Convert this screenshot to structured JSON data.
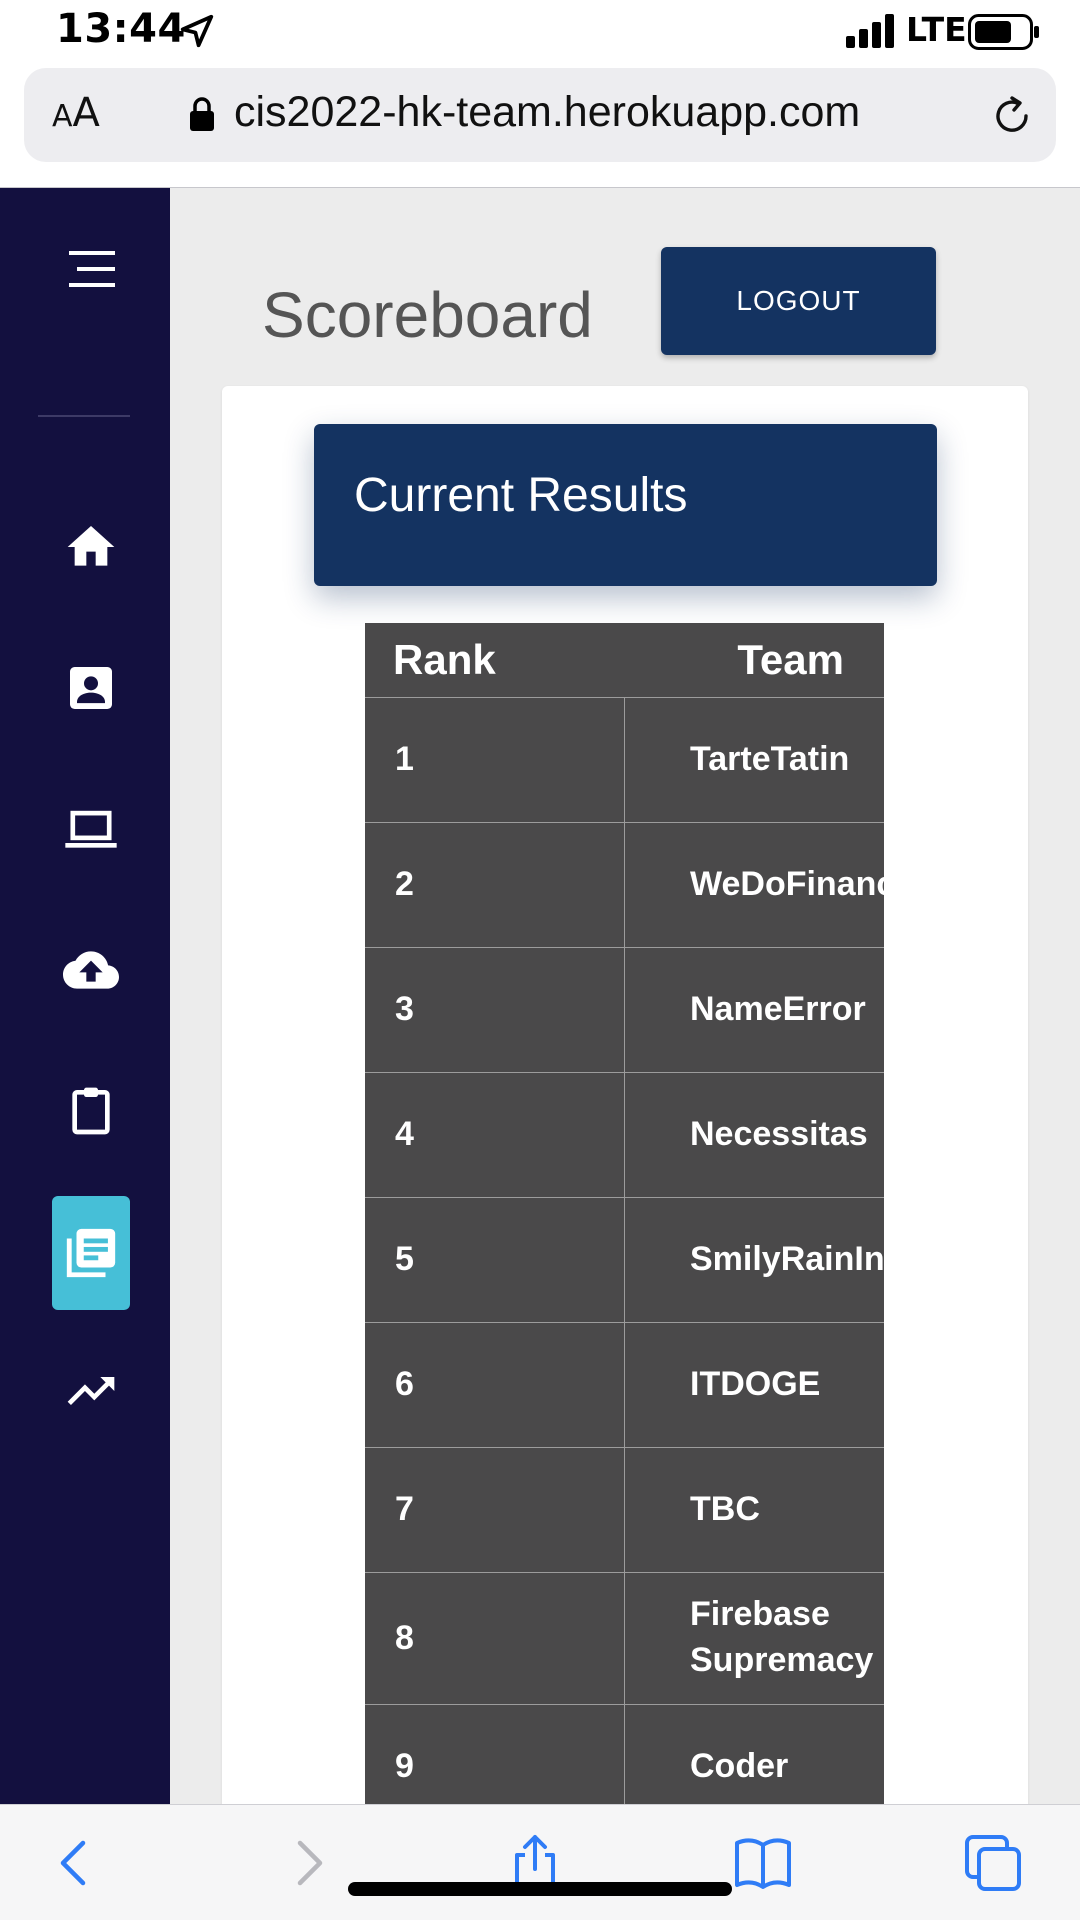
{
  "status_bar": {
    "time": "13:44",
    "network": "LTE"
  },
  "browser": {
    "text_size_small": "A",
    "text_size_large": "A",
    "url": "cis2022-hk-team.herokuapp.com"
  },
  "sidebar": {
    "items": [
      {
        "icon": "menu-icon",
        "active": false
      },
      {
        "icon": "home-icon",
        "active": false
      },
      {
        "icon": "profile-icon",
        "active": false
      },
      {
        "icon": "laptop-icon",
        "active": false
      },
      {
        "icon": "cloud-upload-icon",
        "active": false
      },
      {
        "icon": "clipboard-icon",
        "active": false
      },
      {
        "icon": "scoreboard-icon",
        "active": true
      },
      {
        "icon": "trending-up-icon",
        "active": false
      }
    ],
    "bg_color": "#13103f",
    "active_color": "#46bfd7"
  },
  "header": {
    "title": "Scoreboard",
    "logout_label": "LOGOUT"
  },
  "card": {
    "title": "Current Results"
  },
  "table": {
    "headers": [
      "Rank",
      "Team"
    ],
    "rows": [
      {
        "rank": "1",
        "team": "TarteTatin"
      },
      {
        "rank": "2",
        "team": "WeDoFinance"
      },
      {
        "rank": "3",
        "team": "NameError"
      },
      {
        "rank": "4",
        "team": "Necessitas"
      },
      {
        "rank": "5",
        "team": "SmilyRainInBer"
      },
      {
        "rank": "6",
        "team": "ITDOGE"
      },
      {
        "rank": "7",
        "team": "TBC"
      },
      {
        "rank": "8",
        "team": "Firebase Supremacy"
      },
      {
        "rank": "9",
        "team": "Coder"
      }
    ]
  },
  "colors": {
    "primary": "#143361",
    "table_bg": "#4a494a",
    "page_bg": "#ececec",
    "ios_blue": "#2f7cf6"
  }
}
